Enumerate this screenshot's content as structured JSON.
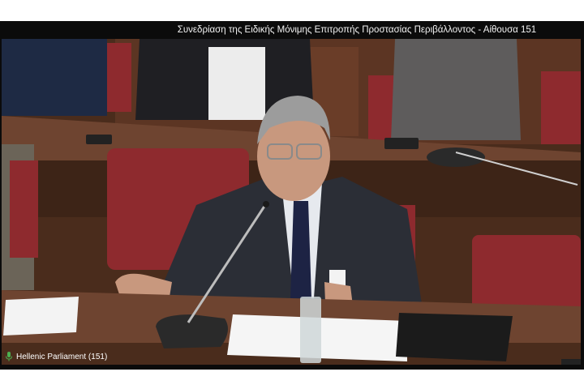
{
  "header": {
    "session_title": "Συνεδρίαση της Ειδικής Μόνιμης Επιτροπής Προστασίας Περιβάλλοντος - Αίθουσα 151"
  },
  "footer": {
    "channel_label": "Hellenic Parliament (151)",
    "channel_icon": "microphone-icon"
  },
  "colors": {
    "wood_dark": "#4a2c1c",
    "wood_mid": "#6e4430",
    "chair_red": "#8e2a2e",
    "suit": "#2b2e36",
    "bar_bg": "#0b0b0b"
  }
}
